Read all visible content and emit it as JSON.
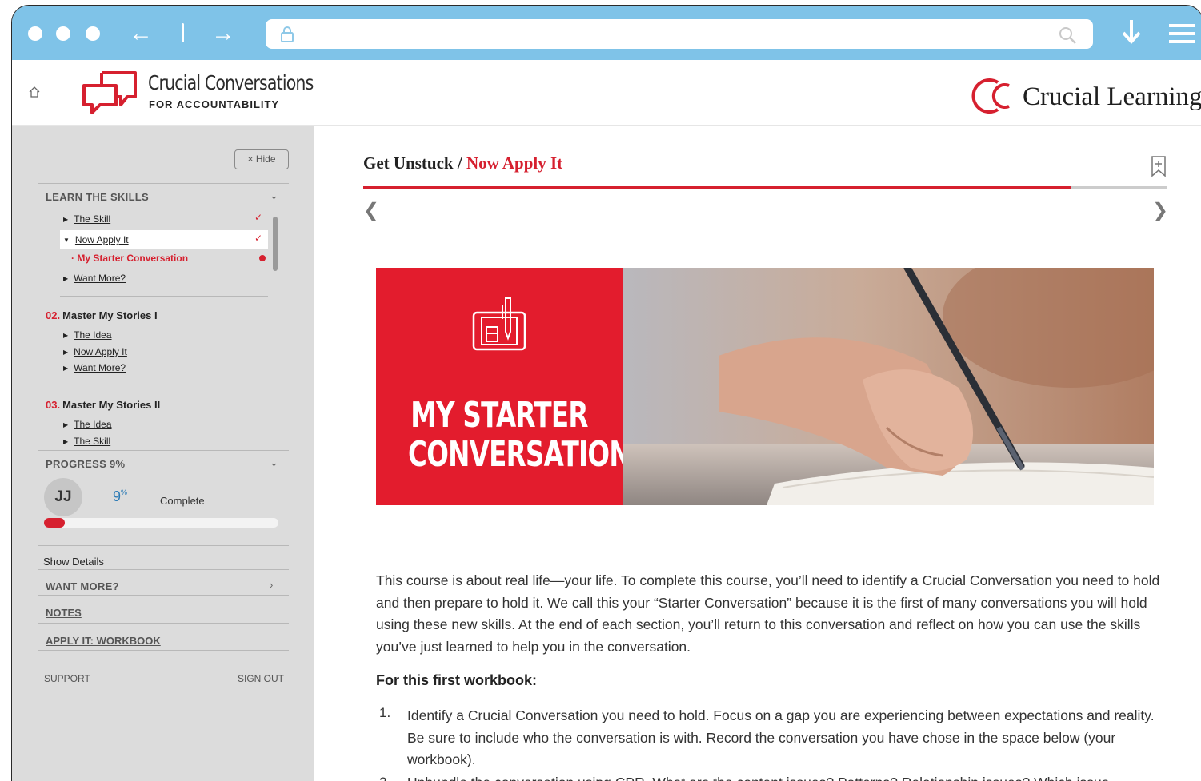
{
  "brand": {
    "product_title": "Crucial Conversations",
    "product_subtitle": "FOR ACCOUNTABILITY",
    "company": "Crucial Learning",
    "accent_color": "#d6202f"
  },
  "sidebar": {
    "hide_label": "Hide",
    "learn_skills": {
      "heading": "LEARN THE SKILLS",
      "items": [
        {
          "label": "The Skill",
          "completed": true
        },
        {
          "label": "Now Apply It",
          "completed": true,
          "expanded": true
        },
        {
          "label": "My Starter Conversation",
          "current": true
        },
        {
          "label": "Want More?"
        }
      ]
    },
    "modules": [
      {
        "number": "02.",
        "title": "Master My Stories I",
        "items": [
          "The Idea",
          "Now Apply It",
          "Want More?"
        ]
      },
      {
        "number": "03.",
        "title": "Master My Stories II",
        "items": [
          "The Idea",
          "The Skill"
        ]
      }
    ],
    "progress": {
      "heading": "PROGRESS 9%",
      "initials": "JJ",
      "value": "9",
      "unit": "%",
      "fraction": 0.09,
      "complete_label": "Complete",
      "show_details": "Show Details"
    },
    "want_more": "WANT MORE?",
    "notes": "NOTES",
    "workbook": "APPLY IT: WORKBOOK",
    "support": "SUPPORT",
    "sign_out": "SIGN OUT"
  },
  "main": {
    "breadcrumb_parent": "Get Unstuck",
    "breadcrumb_sep": " / ",
    "breadcrumb_current": "Now Apply It",
    "section_progress_fraction": 0.88,
    "hero_title_line1": "MY STARTER",
    "hero_title_line2": "CONVERSATION",
    "paragraph": "This course is about real life—your life. To complete this course, you’ll need to identify a Crucial Conversation you need to hold and then prepare to hold it. We call this your “Starter Conversation” because it is the first of many conversations you will hold using these new skills. At the end of each section, you’ll return to this conversation and reflect on how you can use the skills you’ve just learned to help you in the conversation.",
    "workbook_heading": "For this first workbook:",
    "list": [
      {
        "num": "1.",
        "text": "Identify a Crucial Conversation you need to hold. Focus on a gap you are experiencing between expectations and reality. Be sure to include who the conversation is with. Record the conversation you have chose in the space below (your workbook)."
      },
      {
        "num": "2.",
        "text": "Unbundle the conversation using CPR. What are the content issues? Patterns? Relationship issues? Which issue"
      }
    ]
  },
  "icons": [
    "window-dot",
    "back-arrow-icon",
    "forward-arrow-icon",
    "lock-icon",
    "search-icon",
    "download-icon",
    "hamburger-menu-icon",
    "home-icon",
    "speech-bubbles-logo",
    "crucial-learning-logo",
    "bookmark-icon",
    "chevron-left-icon",
    "chevron-right-icon",
    "workbook-pen-icon"
  ]
}
